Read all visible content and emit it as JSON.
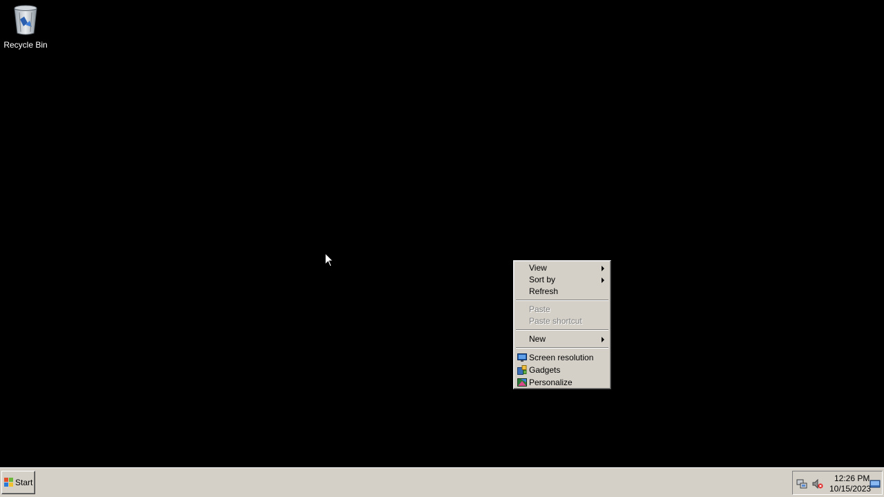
{
  "desktop": {
    "icons": [
      {
        "label": "Recycle Bin",
        "icon": "recycle-bin-icon"
      }
    ]
  },
  "context_menu": {
    "items": [
      {
        "label": "View",
        "has_submenu": true,
        "disabled": false
      },
      {
        "label": "Sort by",
        "has_submenu": true,
        "disabled": false
      },
      {
        "label": "Refresh",
        "has_submenu": false,
        "disabled": false
      },
      {
        "label": "Paste",
        "has_submenu": false,
        "disabled": true
      },
      {
        "label": "Paste shortcut",
        "has_submenu": false,
        "disabled": true
      },
      {
        "label": "New",
        "has_submenu": true,
        "disabled": false
      },
      {
        "label": "Screen resolution",
        "icon": "screen-resolution-icon",
        "disabled": false
      },
      {
        "label": "Gadgets",
        "icon": "gadgets-icon",
        "disabled": false
      },
      {
        "label": "Personalize",
        "icon": "personalize-icon",
        "disabled": false
      }
    ]
  },
  "taskbar": {
    "start_label": "Start",
    "tray": {
      "icons": [
        "network-icon",
        "volume-muted-icon",
        "show-desktop-icon"
      ],
      "time": "12:26 PM",
      "date": "10/15/2023"
    }
  },
  "colors": {
    "desktop_background": "#000000",
    "menu_face": "#d4d0c8",
    "disabled_text": "#808080"
  }
}
